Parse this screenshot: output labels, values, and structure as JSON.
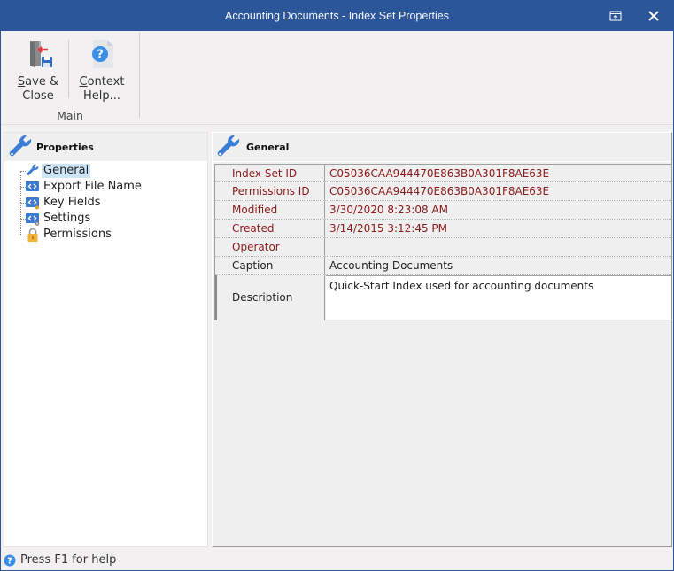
{
  "window": {
    "title": "Accounting Documents - Index Set Properties",
    "restore_icon": "restore-window-icon",
    "close_icon": "close-icon"
  },
  "ribbon": {
    "buttons": [
      {
        "label_line1": "Save &",
        "label_line2": "Close",
        "mnemonic": "S",
        "icon": "save-close-icon"
      },
      {
        "label_line1": "Context",
        "label_line2": "Help...",
        "mnemonic": "C",
        "icon": "help-document-icon"
      }
    ],
    "group_label": "Main"
  },
  "left_pane": {
    "header": "Properties",
    "header_icon": "wrench-icon",
    "tree": [
      {
        "label": "General",
        "icon": "wrench-icon",
        "selected": true
      },
      {
        "label": "Export File Name",
        "icon": "code-tag-icon",
        "selected": false
      },
      {
        "label": "Key Fields",
        "icon": "code-tag-key-icon",
        "selected": false
      },
      {
        "label": "Settings",
        "icon": "code-tag-gear-icon",
        "selected": false
      },
      {
        "label": "Permissions",
        "icon": "lock-icon",
        "selected": false
      }
    ]
  },
  "right_pane": {
    "header": "General",
    "header_icon": "wrench-icon",
    "properties": [
      {
        "key": "Index Set ID",
        "value": "C05036CAA944470E863B0A301F8AE63E",
        "readonly": true
      },
      {
        "key": "Permissions ID",
        "value": "C05036CAA944470E863B0A301F8AE63E",
        "readonly": true
      },
      {
        "key": "Modified",
        "value": "3/30/2020 8:23:08 AM",
        "readonly": true
      },
      {
        "key": "Created",
        "value": "3/14/2015 3:12:45 PM",
        "readonly": true
      },
      {
        "key": "Operator",
        "value": "",
        "readonly": true
      },
      {
        "key": "Caption",
        "value": "Accounting Documents",
        "readonly": false
      },
      {
        "key": "Description",
        "value": "Quick-Start Index used for accounting documents",
        "readonly": false
      }
    ]
  },
  "statusbar": {
    "text": "Press F1 for help",
    "icon": "help-icon"
  },
  "colors": {
    "titlebar": "#2b579a",
    "readonly_text": "#8b1a1a",
    "selection": "#cde6f7",
    "accent_icon": "#3a7fd5"
  }
}
